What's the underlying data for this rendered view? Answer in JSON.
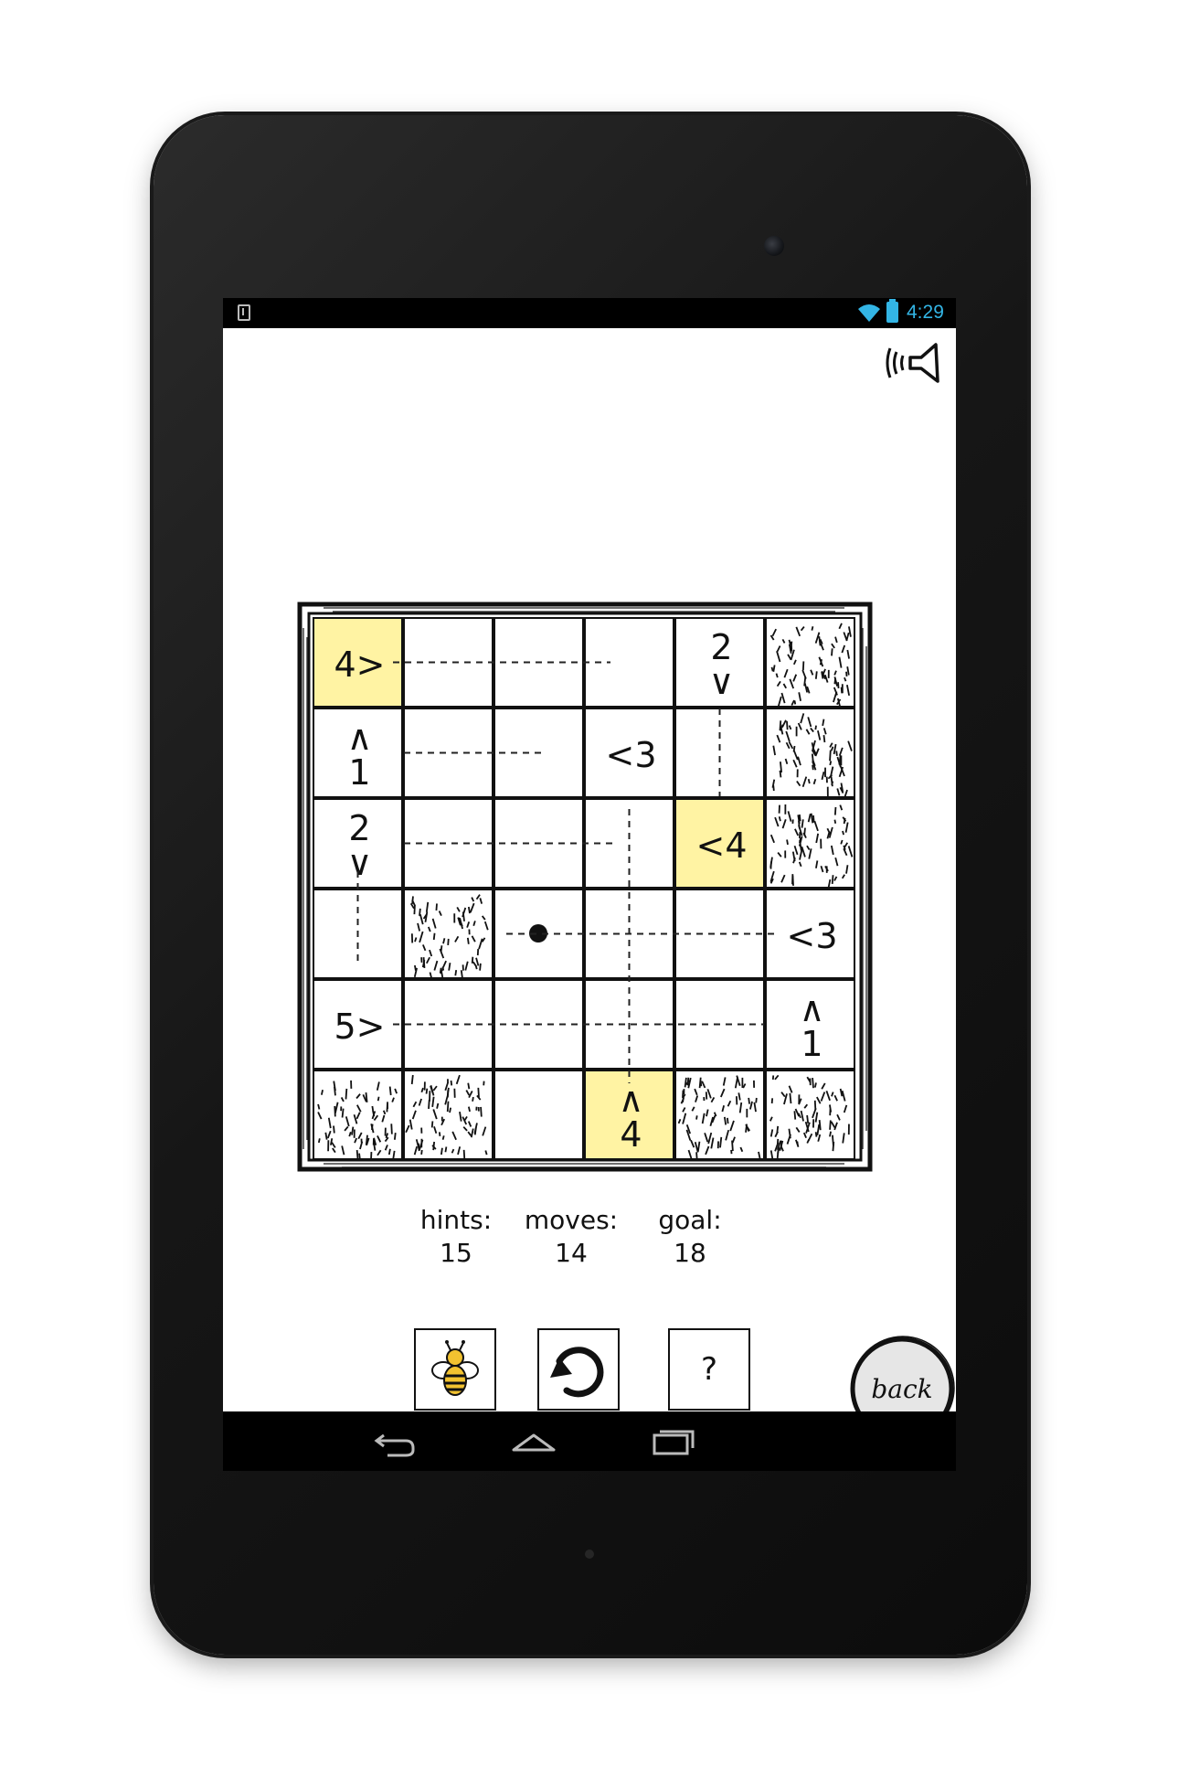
{
  "status_bar": {
    "time": "4:29"
  },
  "board": {
    "rows": [
      [
        {
          "type": "clue",
          "text": "4>",
          "yellow": true
        },
        {
          "type": "empty",
          "text": ""
        },
        {
          "type": "empty",
          "text": ""
        },
        {
          "type": "empty",
          "text": ""
        },
        {
          "type": "clue",
          "text": "2\n∨",
          "yellow": false
        },
        {
          "type": "grass",
          "text": ""
        }
      ],
      [
        {
          "type": "clue",
          "text": "∧\n1",
          "yellow": false
        },
        {
          "type": "empty",
          "text": ""
        },
        {
          "type": "empty",
          "text": ""
        },
        {
          "type": "clue",
          "text": "<3",
          "yellow": false
        },
        {
          "type": "empty",
          "text": ""
        },
        {
          "type": "grass",
          "text": ""
        }
      ],
      [
        {
          "type": "clue",
          "text": "2\n∨",
          "yellow": false
        },
        {
          "type": "empty",
          "text": ""
        },
        {
          "type": "empty",
          "text": ""
        },
        {
          "type": "empty",
          "text": ""
        },
        {
          "type": "clue",
          "text": "<4",
          "yellow": true
        },
        {
          "type": "grass",
          "text": ""
        }
      ],
      [
        {
          "type": "empty",
          "text": ""
        },
        {
          "type": "grass",
          "text": ""
        },
        {
          "type": "dot",
          "text": ""
        },
        {
          "type": "empty",
          "text": ""
        },
        {
          "type": "empty",
          "text": ""
        },
        {
          "type": "clue",
          "text": "<3",
          "yellow": false
        }
      ],
      [
        {
          "type": "clue",
          "text": "5>",
          "yellow": false
        },
        {
          "type": "empty",
          "text": ""
        },
        {
          "type": "empty",
          "text": ""
        },
        {
          "type": "empty",
          "text": ""
        },
        {
          "type": "empty",
          "text": ""
        },
        {
          "type": "clue",
          "text": "∧\n1",
          "yellow": false
        }
      ],
      [
        {
          "type": "grass",
          "text": ""
        },
        {
          "type": "grass",
          "text": ""
        },
        {
          "type": "empty",
          "text": ""
        },
        {
          "type": "clue",
          "text": "∧\n4",
          "yellow": true
        },
        {
          "type": "grass",
          "text": ""
        },
        {
          "type": "grass",
          "text": ""
        }
      ]
    ]
  },
  "stats": {
    "hints_label": "hints:",
    "hints_value": "15",
    "moves_label": "moves:",
    "moves_value": "14",
    "goal_label": "goal:",
    "goal_value": "18"
  },
  "buttons": {
    "help_label": "?",
    "back_label": "back"
  },
  "icons": {
    "sound": "sound-speaker-icon",
    "hint": "bee-icon",
    "restart": "restart-arrow-icon",
    "nav_back": "nav-back-icon",
    "nav_home": "nav-home-icon",
    "nav_recents": "nav-recents-icon"
  },
  "colors": {
    "yellow_cell": "#fff3a3",
    "status_accent": "#33b5e5"
  }
}
